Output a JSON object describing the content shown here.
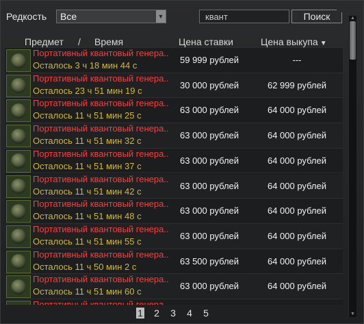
{
  "toolbar": {
    "rarity_label": "Редкость",
    "rarity_value": "Все",
    "rarity_arrow_icon": "triangle-down",
    "search_value": "квант",
    "search_button": "Поиск"
  },
  "header": {
    "item": "Предмет",
    "separator": "/",
    "time": "Время",
    "bid": "Цена ставки",
    "buyout": "Цена выкупа",
    "sort_icon": "▼"
  },
  "rows": [
    {
      "name": "Портативный квантовый генера..",
      "time": "Осталось 3 ч 18 мин 44 с",
      "bid": "59 999 рублей",
      "buyout": "---"
    },
    {
      "name": "Портативный квантовый генера..",
      "time": "Осталось 23 ч 51 мин 19 с",
      "bid": "30 000 рублей",
      "buyout": "62 999 рублей"
    },
    {
      "name": "Портативный квантовый генера..",
      "time": "Осталось 11 ч 51 мин 25 с",
      "bid": "63 000 рублей",
      "buyout": "64 000 рублей"
    },
    {
      "name": "Портативный квантовый генера..",
      "time": "Осталось 11 ч 51 мин 32 с",
      "bid": "63 000 рублей",
      "buyout": "64 000 рублей"
    },
    {
      "name": "Портативный квантовый генера..",
      "time": "Осталось 11 ч 51 мин 37 с",
      "bid": "63 000 рублей",
      "buyout": "64 000 рублей"
    },
    {
      "name": "Портативный квантовый генера..",
      "time": "Осталось 11 ч 51 мин 42 с",
      "bid": "63 000 рублей",
      "buyout": "64 000 рублей"
    },
    {
      "name": "Портативный квантовый генера..",
      "time": "Осталось 11 ч 51 мин 48 с",
      "bid": "63 000 рублей",
      "buyout": "64 000 рублей"
    },
    {
      "name": "Портативный квантовый генера..",
      "time": "Осталось 11 ч 51 мин 55 с",
      "bid": "63 000 рублей",
      "buyout": "64 000 рублей"
    },
    {
      "name": "Портативный квантовый генера..",
      "time": "Осталось 11 ч 50 мин 2 с",
      "bid": "63 500 рублей",
      "buyout": "64 000 рублей"
    },
    {
      "name": "Портативный квантовый генера..",
      "time": "Осталось 11 ч 51 мин 60 с",
      "bid": "63 000 рублей",
      "buyout": "64 000 рублей"
    },
    {
      "name": "Портативный квантовый генера..",
      "time": "",
      "bid": "",
      "buyout": ""
    }
  ],
  "pagination": {
    "pages": [
      "1",
      "2",
      "3",
      "4",
      "5"
    ],
    "active": "1"
  },
  "colors": {
    "item_name": "#ff3b3b",
    "time_left": "#d4b72a",
    "price": "#f2f2f2",
    "background": "#1a1b1c"
  }
}
